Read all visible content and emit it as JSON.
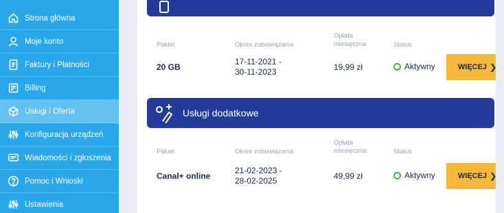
{
  "sidebar": {
    "items": [
      {
        "label": "Strona główna",
        "icon": "home-icon"
      },
      {
        "label": "Moje konto",
        "icon": "user-icon"
      },
      {
        "label": "Faktury i Płatności",
        "icon": "invoice-icon"
      },
      {
        "label": "Billing",
        "icon": "billing-icon"
      },
      {
        "label": "Usługi i Oferta",
        "icon": "box-icon"
      },
      {
        "label": "Konfiguracja urządzeń",
        "icon": "sliders-icon"
      },
      {
        "label": "Wiadomości i zgłoszenia",
        "icon": "message-icon"
      },
      {
        "label": "Pomoc i Wnioski",
        "icon": "help-icon"
      },
      {
        "label": "Ustawienia",
        "icon": "settings-icon"
      }
    ],
    "active_index": 4
  },
  "packages": {
    "headers": {
      "package": "Pakiet",
      "period": "Okres zobowiązania",
      "fee_line1": "Opłata",
      "fee_line2": "miesięczna",
      "status": "Status"
    },
    "row": {
      "name": "20 GB",
      "period_line1": "17-11-2021 -",
      "period_line2": "30-11-2023",
      "fee": "19,99 zł",
      "status": "Aktywny",
      "button": "WIĘCEJ"
    }
  },
  "additional": {
    "title": "Usługi dodatkowe",
    "headers": {
      "package": "Pakiet",
      "period": "Okres zobowiązania",
      "fee_line1": "Opłata",
      "fee_line2": "miesięczna",
      "status": "Status"
    },
    "row": {
      "name": "Canal+ online",
      "period_line1": "21-02-2023 -",
      "period_line2": "28-02-2025",
      "fee": "49,99 zł",
      "status": "Aktywny",
      "button": "WIĘCEJ"
    }
  },
  "colors": {
    "sidebar": "#29a7e8",
    "banner": "#253b9a",
    "button": "#f6b83a",
    "active_status": "#3bb54a"
  }
}
